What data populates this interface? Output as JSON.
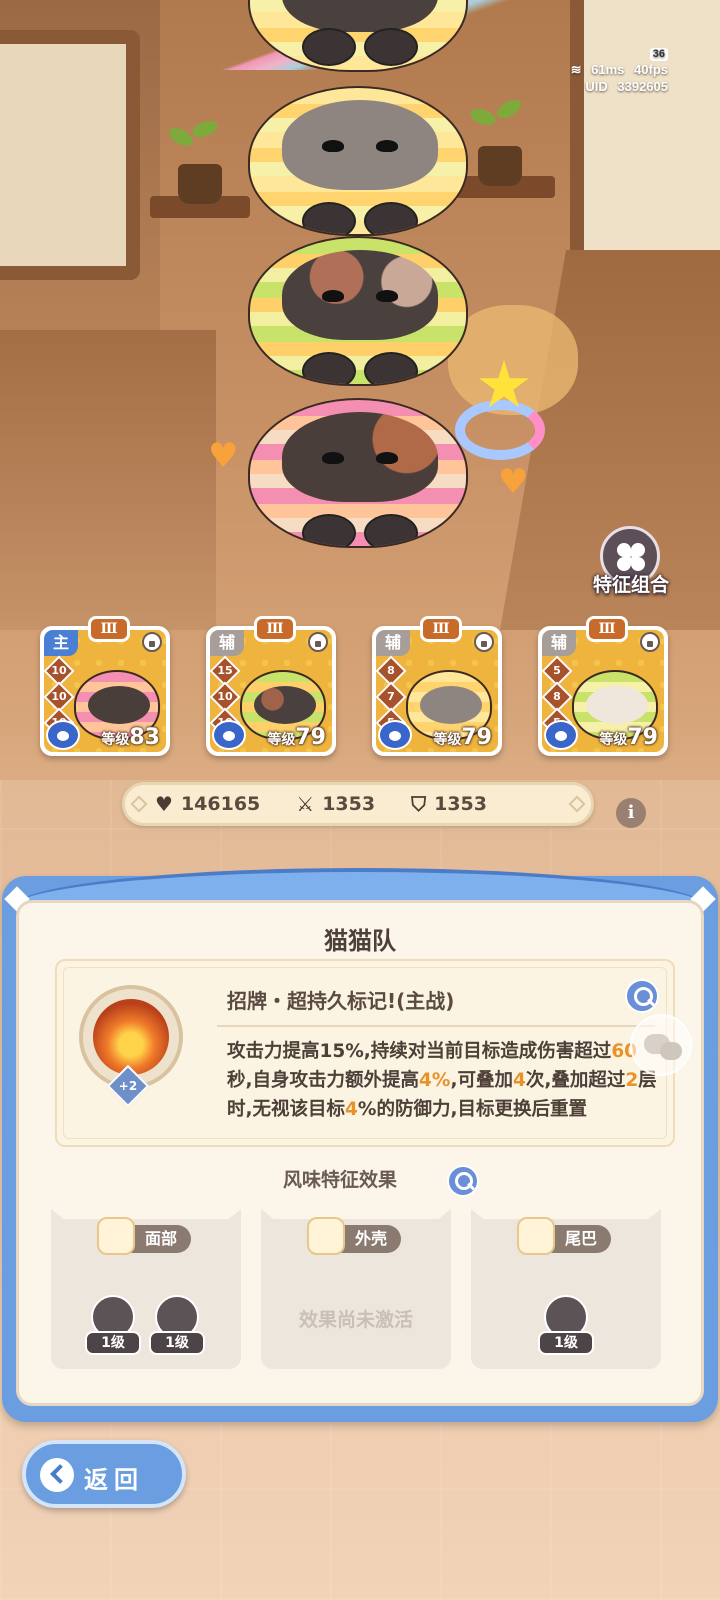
{
  "hud": {
    "battery": "36",
    "ping": "61ms",
    "fps": "40fps",
    "uid_label": "UID",
    "uid": "3392605"
  },
  "feature_combo": {
    "label": "特征组合",
    "icon": "clover-icon"
  },
  "members": [
    {
      "role": "主",
      "rank": "Ⅲ",
      "stats": [
        "10",
        "10",
        "10"
      ],
      "level_label": "等级",
      "level": "83"
    },
    {
      "role": "辅",
      "rank": "Ⅲ",
      "stats": [
        "15",
        "10",
        "10"
      ],
      "level_label": "等级",
      "level": "79"
    },
    {
      "role": "辅",
      "rank": "Ⅲ",
      "stats": [
        "8",
        "7",
        "5"
      ],
      "level_label": "等级",
      "level": "79"
    },
    {
      "role": "辅",
      "rank": "Ⅲ",
      "stats": [
        "5",
        "8",
        "5"
      ],
      "level_label": "等级",
      "level": "79"
    }
  ],
  "stats": {
    "hp": "146165",
    "attack": "1353",
    "defense": "1353"
  },
  "panel": {
    "title": "猫猫队",
    "skill": {
      "name": "招牌・超持久标记!(主战)",
      "plus": "+2",
      "desc_1": "攻击力提高15%,持续对当前目标造成伤害超过",
      "desc_hl1": "60",
      "desc_2": "秒,自身攻击力额外提高",
      "desc_hl2": "4%",
      "desc_3": ",可叠加",
      "desc_hl3": "4",
      "desc_4": "次,叠加超过",
      "desc_hl4": "2",
      "desc_5": "层时,无视该目标",
      "desc_hl5": "4",
      "desc_6": "%的防御力,目标更换后重置"
    },
    "flavor_title": "风味特征效果",
    "slots": [
      {
        "name": "面部",
        "traits": [
          "1级",
          "1级"
        ]
      },
      {
        "name": "外壳",
        "empty": "效果尚未激活"
      },
      {
        "name": "尾巴",
        "traits": [
          "1级"
        ]
      }
    ]
  },
  "back": {
    "label": "返回"
  }
}
